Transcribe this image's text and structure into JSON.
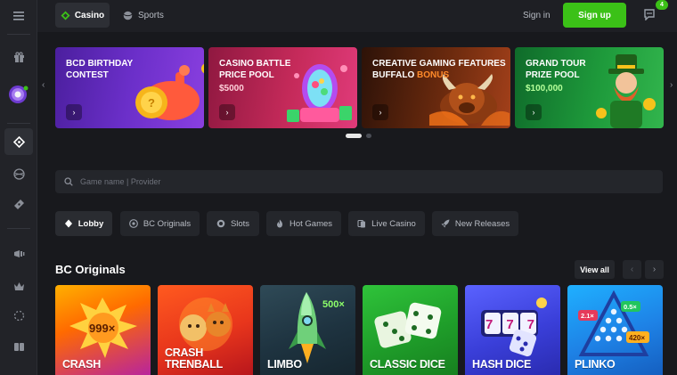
{
  "header": {
    "tab_casino": "Casino",
    "tab_sports": "Sports",
    "signin": "Sign in",
    "signup": "Sign up",
    "chat_badge": "4"
  },
  "banners": [
    {
      "line1": "BCD BIRTHDAY",
      "line2": "CONTEST",
      "line3": ""
    },
    {
      "line1": "CASINO BATTLE",
      "line2": "PRICE POOL",
      "line3": "$5000"
    },
    {
      "line1": "CREATIVE GAMING FEATURES",
      "line2": "BUFFALO",
      "line2b": "BONUS",
      "line3": ""
    },
    {
      "line1": "GRAND TOUR",
      "line2": "PRIZE POOL",
      "line3": "$100,000"
    }
  ],
  "carousel": {
    "pages": 2,
    "active": 1
  },
  "search": {
    "placeholder": "Game name | Provider"
  },
  "categories": [
    "Lobby",
    "BC Originals",
    "Slots",
    "Hot Games",
    "Live Casino",
    "New Releases"
  ],
  "section": {
    "title": "BC Originals",
    "view_all": "View all"
  },
  "games": [
    {
      "name": "CRASH",
      "badge": "999×"
    },
    {
      "name": "CRASH TRENBALL",
      "line1": "CRASH",
      "line2": "TRENBALL"
    },
    {
      "name": "LIMBO",
      "badge": "500×"
    },
    {
      "name": "CLASSIC DICE"
    },
    {
      "name": "HASH DICE",
      "badge": "777"
    },
    {
      "name": "PLINKO",
      "badge1": "2.1×",
      "badge2": "0.5×",
      "badge3": "420×"
    }
  ],
  "colors": {
    "accent": "#3bc117",
    "bg": "#18191d",
    "panel": "#24262b"
  }
}
